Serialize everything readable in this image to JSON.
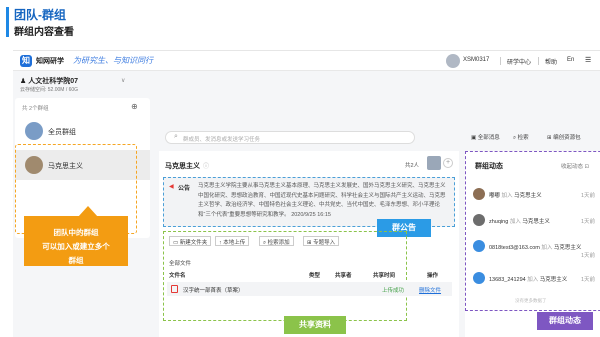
{
  "slide": {
    "title": "团队-群组",
    "subtitle": "群组内容查看"
  },
  "topbar": {
    "logo_icon": "知",
    "logo_text": "知网研学",
    "slogan": "为研究生、与知识同行",
    "user_id": "XSM0317",
    "nav": [
      "研学中心",
      "帮助",
      "En"
    ]
  },
  "sidebar": {
    "org_name": "人文社科学院07",
    "space": "云存储空间: 52.00M / 60G",
    "group_count": "共 2个群组",
    "groups": [
      {
        "name": "全员群组"
      },
      {
        "name": "马克思主义"
      }
    ]
  },
  "callout": {
    "line1": "团队中的群组",
    "line2": "可以加入或建立多个",
    "line3": "群组"
  },
  "search": {
    "placeholder": "群成员、发消息或发送学习任务"
  },
  "toolbar": {
    "all_messages": "全部消息",
    "search": "检索",
    "resource": "编创资源包"
  },
  "group": {
    "name": "马克思主义",
    "member_count": "共2人",
    "announcement_label": "公告",
    "announcement_text": "马克思主义学院主要从事马克思主义基本原理、马克思主义发展史、国外马克思主义研究、马克思主义中国化研究、思想政治教育、中国近现代史基本问题研究、科学社会主义与国际共产主义运动、马克思主义哲学、政治经济学、中国特色社会主义理论、中共党史、当代中国史、毛泽东思想、邓小平理论和“三个代表”重要思想等研究和教学。 2020/9/25 16:15",
    "announcement_tag": "群公告"
  },
  "files": {
    "buttons": [
      "新建文件夹",
      "本地上传",
      "检索添加",
      "专题导入"
    ],
    "all_files": "全部文件",
    "headers": [
      "文件名",
      "类型",
      "共享者",
      "共享时间",
      "操作"
    ],
    "rows": [
      {
        "name": "汉字统一部首表（草案）",
        "status": "上传成功",
        "action": "删除文件"
      }
    ],
    "tag": "共享资料"
  },
  "activity": {
    "title": "群组动态",
    "collapse": "收起动态",
    "items": [
      {
        "user": "嘟嘟",
        "verb": "加入",
        "target": "马克思主义",
        "time": "1天前"
      },
      {
        "user": "zhuqing",
        "verb": "加入",
        "target": "马克思主义",
        "time": "1天前"
      },
      {
        "user": "0818test3@163.com",
        "verb": "加入",
        "target": "马克思主义",
        "time": "1天前"
      },
      {
        "user": "13683_241294",
        "verb": "加入",
        "target": "马克思主义",
        "time": "1天前"
      }
    ],
    "no_more": "没有更多数据了",
    "tag": "群组动态"
  }
}
